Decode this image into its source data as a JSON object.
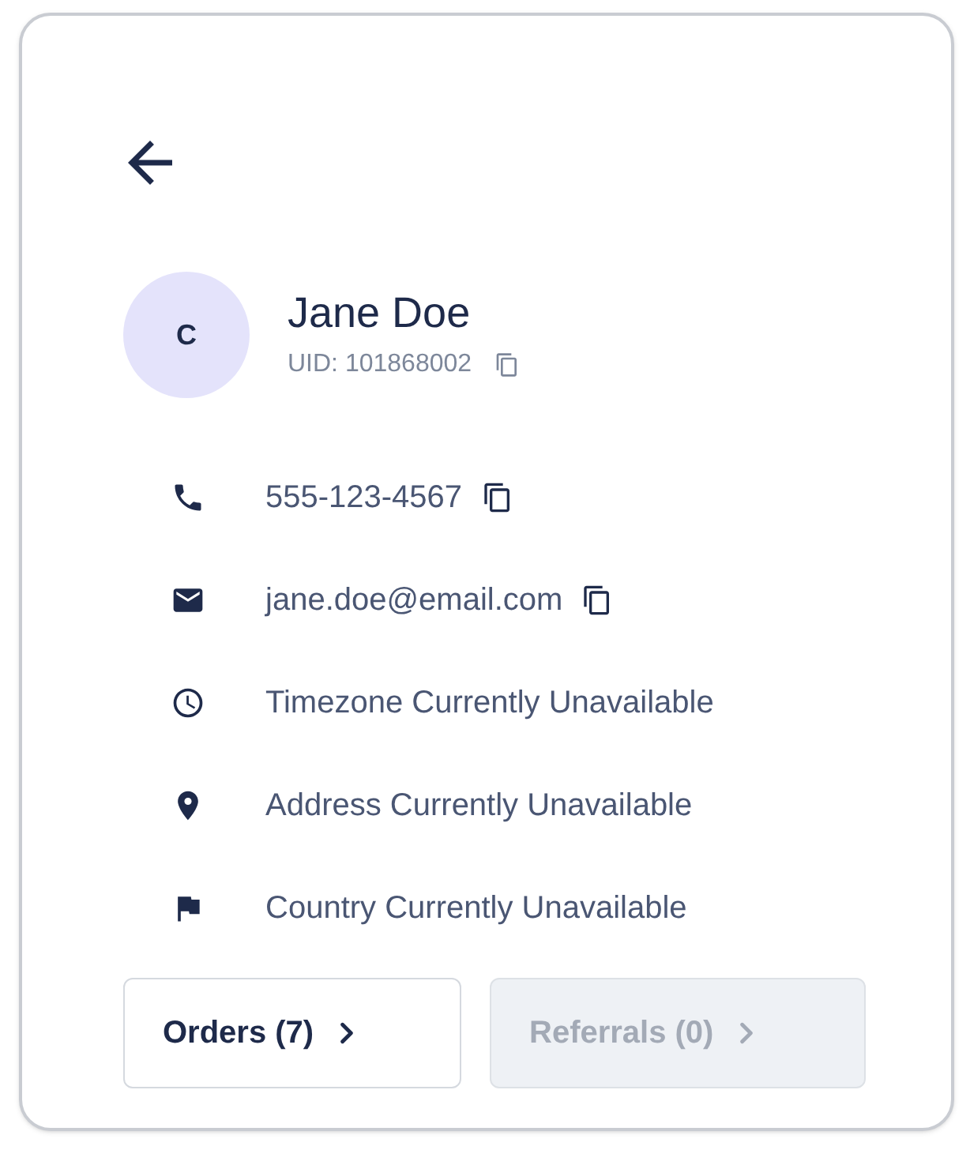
{
  "profile": {
    "initial": "C",
    "name": "Jane Doe",
    "uid": "UID: 101868002",
    "uid_copyable": true
  },
  "details": [
    {
      "kind": "phone",
      "text": "555-123-4567",
      "copyable": true
    },
    {
      "kind": "email",
      "text": "jane.doe@email.com",
      "copyable": true
    },
    {
      "kind": "timezone",
      "text": "Timezone Currently Unavailable",
      "copyable": false
    },
    {
      "kind": "address",
      "text": "Address Currently Unavailable",
      "copyable": false
    },
    {
      "kind": "country",
      "text": "Country Currently Unavailable",
      "copyable": false
    }
  ],
  "buttons": [
    {
      "label": "Orders (7)",
      "disabled": false
    },
    {
      "label": "Referrals (0)",
      "disabled": true
    }
  ]
}
